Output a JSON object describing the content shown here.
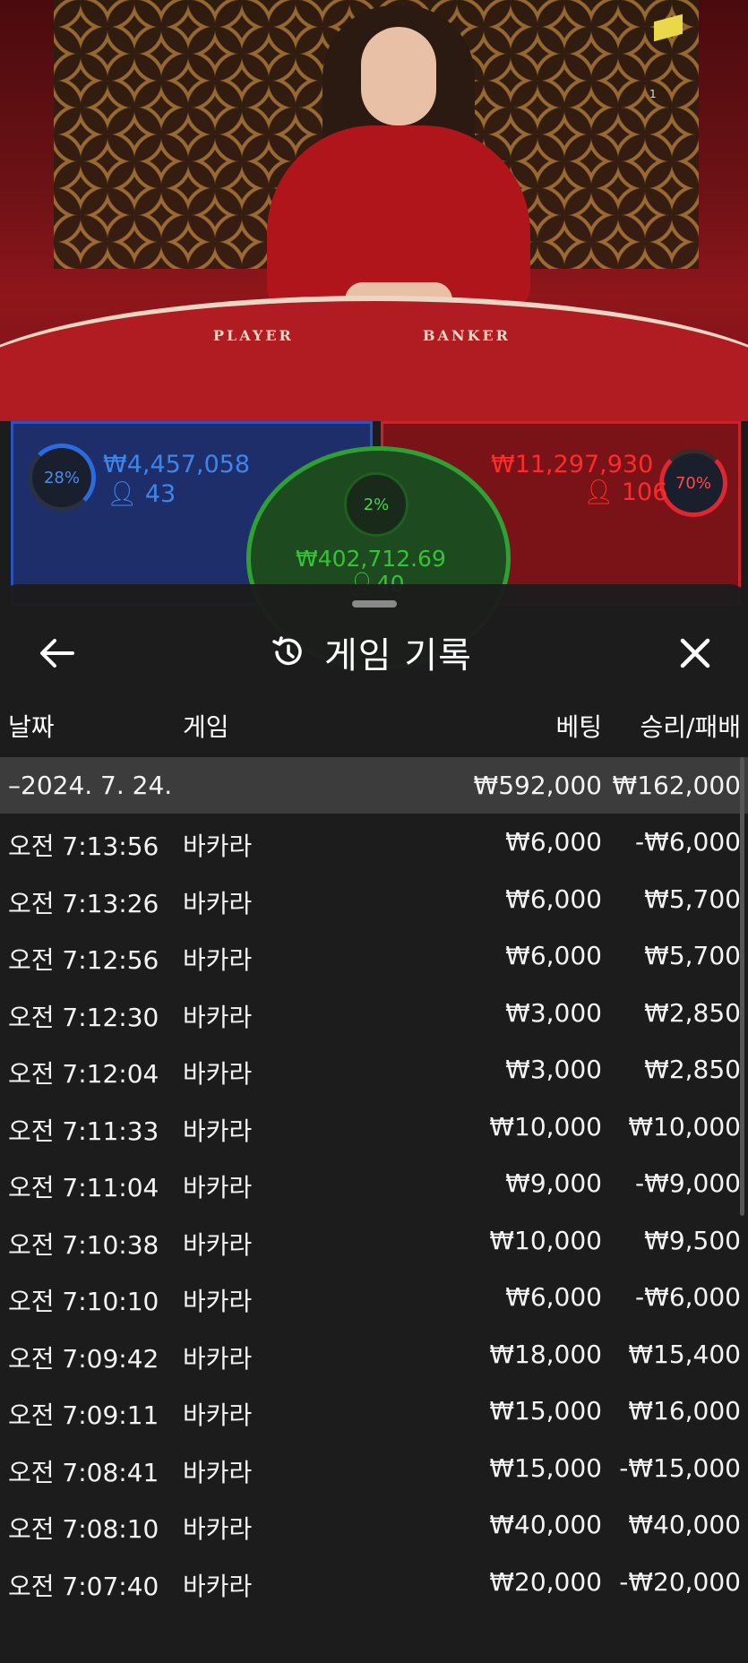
{
  "video": {
    "felt_player": "PLAYER",
    "felt_banker": "BANKER",
    "camera_number": "1"
  },
  "bets": {
    "player": {
      "percent": "28%",
      "amount": "₩4,457,058",
      "players": "43",
      "color": "#4a8df0"
    },
    "tie": {
      "percent": "2%",
      "amount": "₩402,712.69",
      "players": "40",
      "color": "#35c235"
    },
    "banker": {
      "percent": "70%",
      "amount": "₩11,297,930",
      "players": "106",
      "color": "#ff2a2a"
    }
  },
  "sheet": {
    "title": "게임 기록",
    "icons": {
      "back": "arrow-left-icon",
      "history": "history-icon",
      "close": "close-icon"
    },
    "columns": {
      "date": "날짜",
      "game": "게임",
      "bet": "베팅",
      "result": "승리/패배"
    },
    "date_group": {
      "date": "–2024. 7. 24.",
      "bet": "₩592,000",
      "result": "₩162,000"
    },
    "rows": [
      {
        "time": "오전 7:13:56",
        "game": "바카라",
        "bet": "₩6,000",
        "result": "-₩6,000"
      },
      {
        "time": "오전 7:13:26",
        "game": "바카라",
        "bet": "₩6,000",
        "result": "₩5,700"
      },
      {
        "time": "오전 7:12:56",
        "game": "바카라",
        "bet": "₩6,000",
        "result": "₩5,700"
      },
      {
        "time": "오전 7:12:30",
        "game": "바카라",
        "bet": "₩3,000",
        "result": "₩2,850"
      },
      {
        "time": "오전 7:12:04",
        "game": "바카라",
        "bet": "₩3,000",
        "result": "₩2,850"
      },
      {
        "time": "오전 7:11:33",
        "game": "바카라",
        "bet": "₩10,000",
        "result": "₩10,000"
      },
      {
        "time": "오전 7:11:04",
        "game": "바카라",
        "bet": "₩9,000",
        "result": "-₩9,000"
      },
      {
        "time": "오전 7:10:38",
        "game": "바카라",
        "bet": "₩10,000",
        "result": "₩9,500"
      },
      {
        "time": "오전 7:10:10",
        "game": "바카라",
        "bet": "₩6,000",
        "result": "-₩6,000"
      },
      {
        "time": "오전 7:09:42",
        "game": "바카라",
        "bet": "₩18,000",
        "result": "₩15,400"
      },
      {
        "time": "오전 7:09:11",
        "game": "바카라",
        "bet": "₩15,000",
        "result": "₩16,000"
      },
      {
        "time": "오전 7:08:41",
        "game": "바카라",
        "bet": "₩15,000",
        "result": "-₩15,000"
      },
      {
        "time": "오전 7:08:10",
        "game": "바카라",
        "bet": "₩40,000",
        "result": "₩40,000"
      },
      {
        "time": "오전 7:07:40",
        "game": "바카라",
        "bet": "₩20,000",
        "result": "-₩20,000"
      }
    ]
  }
}
